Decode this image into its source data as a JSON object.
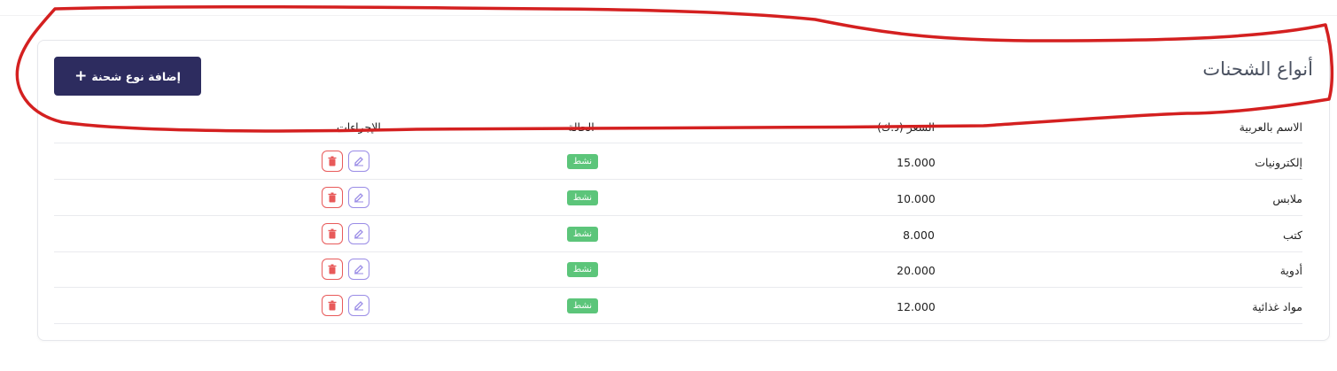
{
  "page": {
    "title": "أنواع الشحنات",
    "add_button_label": "إضافة نوع شحنة",
    "add_button_icon": "plus-icon"
  },
  "table": {
    "columns": [
      "الاسم بالعربية",
      "السعر (د.ك)",
      "الحالة",
      "الإجراءات"
    ],
    "rows": [
      {
        "name": "إلكترونيات",
        "price": "15.000",
        "status": "نشط"
      },
      {
        "name": "ملابس",
        "price": "10.000",
        "status": "نشط"
      },
      {
        "name": "كتب",
        "price": "8.000",
        "status": "نشط"
      },
      {
        "name": "أدوية",
        "price": "20.000",
        "status": "نشط"
      },
      {
        "name": "مواد غذائية",
        "price": "12.000",
        "status": "نشط"
      }
    ],
    "actions": {
      "edit_icon": "edit-icon",
      "delete_icon": "trash-icon"
    }
  },
  "colors": {
    "primary": "#2d2c5f",
    "status_active": "#5cc57a",
    "delete": "#e85a5a",
    "edit": "#9a8ce6",
    "annotation": "#d42020"
  }
}
